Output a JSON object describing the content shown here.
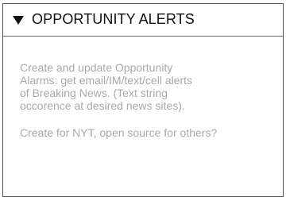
{
  "panel": {
    "title": "OPPORTUNITY ALERTS",
    "expanded": true,
    "toggle_icon": "triangle-down-icon",
    "paragraphs": [
      "Create and update Opportunity\nAlarms: get email/IM/text/cell alerts\nof Breaking News. (Text string\noccorence at desired news sites).",
      "Create for NYT, open source for others?"
    ]
  }
}
